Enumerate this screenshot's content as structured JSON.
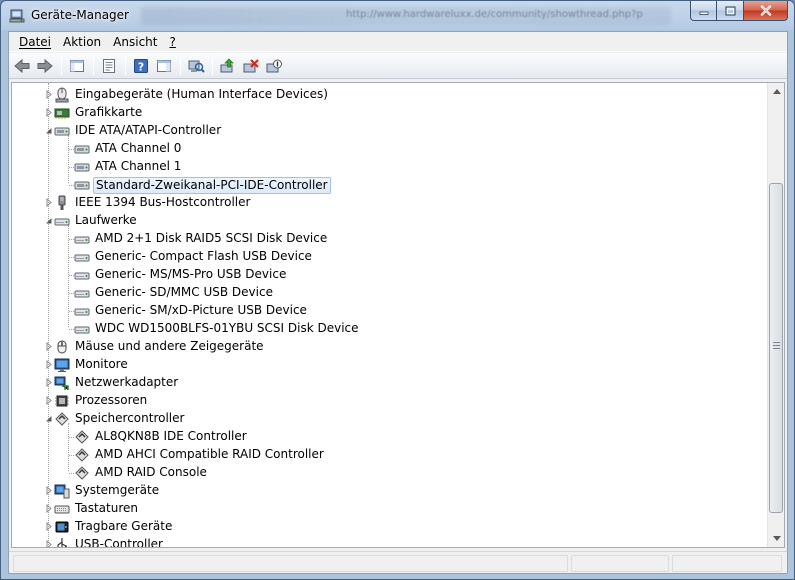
{
  "window": {
    "title": "Geräte-Manager",
    "blurred_text": "http://www.hardwareluxx.de/community/showthread.php?p"
  },
  "menu": [
    "Datei",
    "Aktion",
    "Ansicht",
    "?"
  ],
  "toolbar": {
    "buttons": [
      "back-icon",
      "forward-icon",
      "console-tree-icon",
      "properties-icon",
      "help-icon",
      "action-pane-icon",
      "scan-hardware-icon",
      "update-driver-icon",
      "uninstall-icon",
      "disable-icon"
    ]
  },
  "tree": {
    "nodes": [
      {
        "label": "Eingabegeräte (Human Interface Devices)",
        "level": 0,
        "state": "collapsed",
        "icon": "hid-icon"
      },
      {
        "label": "Grafikkarte",
        "level": 0,
        "state": "collapsed",
        "icon": "display-adapter-icon"
      },
      {
        "label": "IDE ATA/ATAPI-Controller",
        "level": 0,
        "state": "expanded",
        "icon": "ide-controller-icon"
      },
      {
        "label": "ATA Channel 0",
        "level": 1,
        "icon": "ide-channel-icon"
      },
      {
        "label": "ATA Channel 1",
        "level": 1,
        "icon": "ide-channel-icon"
      },
      {
        "label": "Standard-Zweikanal-PCI-IDE-Controller",
        "level": 1,
        "icon": "ide-channel-icon",
        "selected": true
      },
      {
        "label": "IEEE 1394 Bus-Hostcontroller",
        "level": 0,
        "state": "collapsed",
        "icon": "firewire-icon"
      },
      {
        "label": "Laufwerke",
        "level": 0,
        "state": "expanded",
        "icon": "disk-drive-icon"
      },
      {
        "label": "AMD 2+1 Disk RAID5 SCSI Disk Device",
        "level": 1,
        "icon": "disk-drive-icon"
      },
      {
        "label": "Generic- Compact Flash USB Device",
        "level": 1,
        "icon": "disk-drive-icon"
      },
      {
        "label": "Generic- MS/MS-Pro USB Device",
        "level": 1,
        "icon": "disk-drive-icon"
      },
      {
        "label": "Generic- SD/MMC USB Device",
        "level": 1,
        "icon": "disk-drive-icon"
      },
      {
        "label": "Generic- SM/xD-Picture USB Device",
        "level": 1,
        "icon": "disk-drive-icon"
      },
      {
        "label": "WDC WD1500BLFS-01YBU SCSI Disk Device",
        "level": 1,
        "icon": "disk-drive-icon"
      },
      {
        "label": "Mäuse und andere Zeigegeräte",
        "level": 0,
        "state": "collapsed",
        "icon": "mouse-icon"
      },
      {
        "label": "Monitore",
        "level": 0,
        "state": "collapsed",
        "icon": "monitor-icon"
      },
      {
        "label": "Netzwerkadapter",
        "level": 0,
        "state": "collapsed",
        "icon": "network-adapter-icon"
      },
      {
        "label": "Prozessoren",
        "level": 0,
        "state": "collapsed",
        "icon": "processor-icon"
      },
      {
        "label": "Speichercontroller",
        "level": 0,
        "state": "expanded",
        "icon": "storage-controller-icon"
      },
      {
        "label": "AL8QKN8B IDE Controller",
        "level": 1,
        "icon": "scsi-controller-icon"
      },
      {
        "label": "AMD AHCI Compatible RAID Controller",
        "level": 1,
        "icon": "scsi-controller-icon"
      },
      {
        "label": "AMD RAID Console",
        "level": 1,
        "icon": "scsi-controller-icon"
      },
      {
        "label": "Systemgeräte",
        "level": 0,
        "state": "collapsed",
        "icon": "system-devices-icon"
      },
      {
        "label": "Tastaturen",
        "level": 0,
        "state": "collapsed",
        "icon": "keyboard-icon"
      },
      {
        "label": "Tragbare Geräte",
        "level": 0,
        "state": "collapsed",
        "icon": "portable-devices-icon"
      },
      {
        "label": "USB-Controller",
        "level": 0,
        "state": "collapsed",
        "icon": "usb-icon"
      }
    ]
  },
  "colors": {
    "selection_border": "#9fc2eb",
    "selection_fill": "#dbeafb",
    "titlebar": "#b6cbe4",
    "close_button": "#c0391f"
  }
}
